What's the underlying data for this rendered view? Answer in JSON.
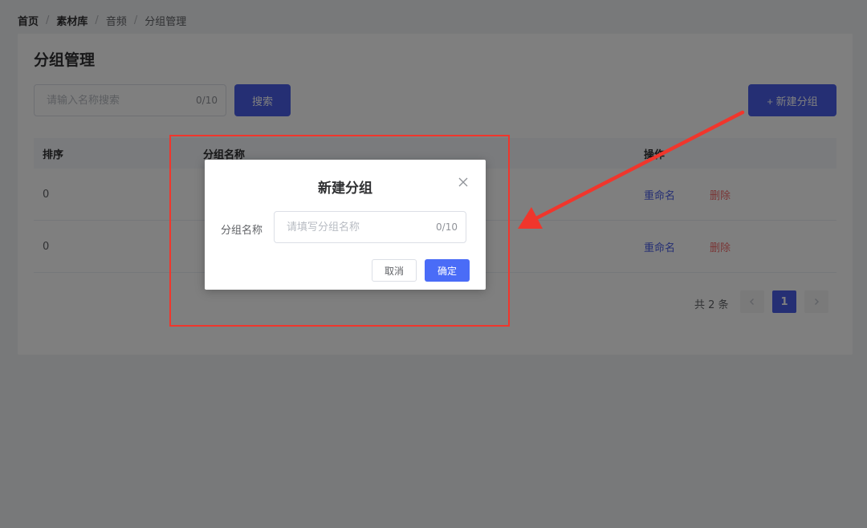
{
  "breadcrumb": [
    "首页",
    "素材库",
    "音频",
    "分组管理"
  ],
  "page": {
    "title": "分组管理",
    "search": {
      "placeholder": "请输入名称搜索",
      "counter": "0/10"
    },
    "search_button": "搜索",
    "new_group_button": "+ 新建分组"
  },
  "table": {
    "headers": {
      "sort": "排序",
      "name": "分组名称",
      "actions": "操作"
    },
    "rows": [
      {
        "sort": "0",
        "rename": "重命名",
        "delete": "删除"
      },
      {
        "sort": "0",
        "rename": "重命名",
        "delete": "删除"
      }
    ]
  },
  "pagination": {
    "total": "共 2 条",
    "current": "1"
  },
  "dialog": {
    "title": "新建分组",
    "label": "分组名称",
    "placeholder": "请填写分组名称",
    "counter": "0/10",
    "cancel": "取消",
    "confirm": "确定"
  },
  "colors": {
    "primary": "#4a5fe8",
    "danger": "#f56c6c",
    "annotation": "#f0362c"
  }
}
